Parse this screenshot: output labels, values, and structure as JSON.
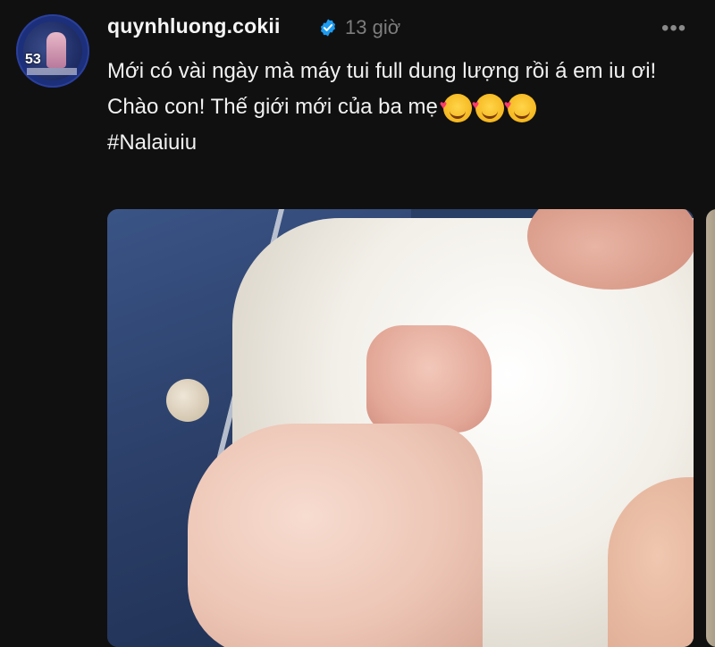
{
  "post": {
    "username": "quynhluong.cokii",
    "timestamp": "13 giờ",
    "more_icon": "•••",
    "text_line1": "Mới có vài ngày mà máy tui full dung lượng rồi á em iu ơi!",
    "text_line2": "Chào con! Thế giới mới của ba mẹ",
    "hashtag": "#Nalaiuiu",
    "emojis": [
      "smiling-face-with-hearts",
      "smiling-face-with-hearts",
      "smiling-face-with-hearts"
    ],
    "avatar_badge": "53"
  },
  "colors": {
    "background": "#101010",
    "verified": "#1d9bf0",
    "timestamp": "#7d7d7d"
  }
}
